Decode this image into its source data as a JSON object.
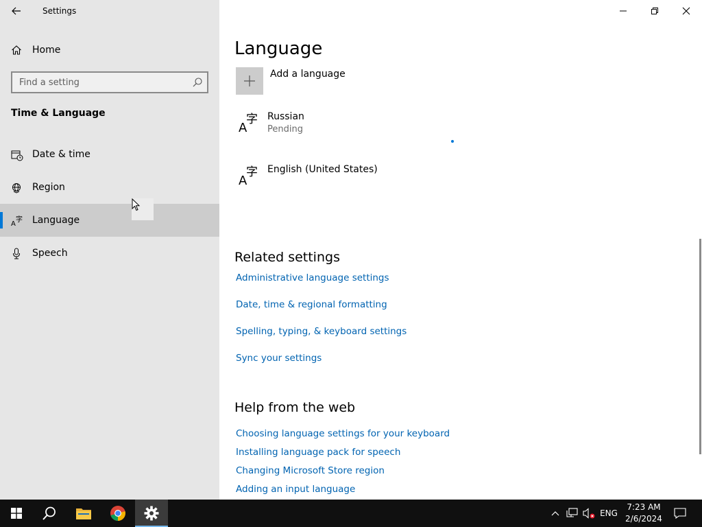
{
  "window": {
    "app_title": "Settings"
  },
  "sidebar": {
    "home_label": "Home",
    "search": {
      "placeholder": "Find a setting",
      "value": ""
    },
    "section_title": "Time & Language",
    "items": [
      {
        "label": "Date & time",
        "icon": "clock-calendar-icon",
        "selected": false
      },
      {
        "label": "Region",
        "icon": "globe-icon",
        "selected": false
      },
      {
        "label": "Language",
        "icon": "language-icon",
        "selected": true
      },
      {
        "label": "Speech",
        "icon": "microphone-icon",
        "selected": false
      }
    ]
  },
  "main": {
    "title": "Language",
    "add_language_label": "Add a language",
    "languages": [
      {
        "name": "Russian",
        "status": "Pending"
      },
      {
        "name": "English (United States)",
        "status": ""
      }
    ],
    "related_settings": {
      "heading": "Related settings",
      "links": [
        "Administrative language settings",
        "Date, time & regional formatting",
        "Spelling, typing, & keyboard settings",
        "Sync your settings"
      ]
    },
    "help": {
      "heading": "Help from the web",
      "links": [
        "Choosing language settings for your keyboard",
        "Installing language pack for speech",
        "Changing Microsoft Store region",
        "Adding an input language"
      ]
    }
  },
  "taskbar": {
    "tray": {
      "input_language": "ENG",
      "time": "7:23 AM",
      "date": "2/6/2024"
    }
  },
  "colors": {
    "accent": "#0078d7",
    "link": "#0063b1",
    "sidebar_bg": "#e6e6e6",
    "selected_bg": "#cccccc",
    "taskbar_bg": "#101010"
  }
}
